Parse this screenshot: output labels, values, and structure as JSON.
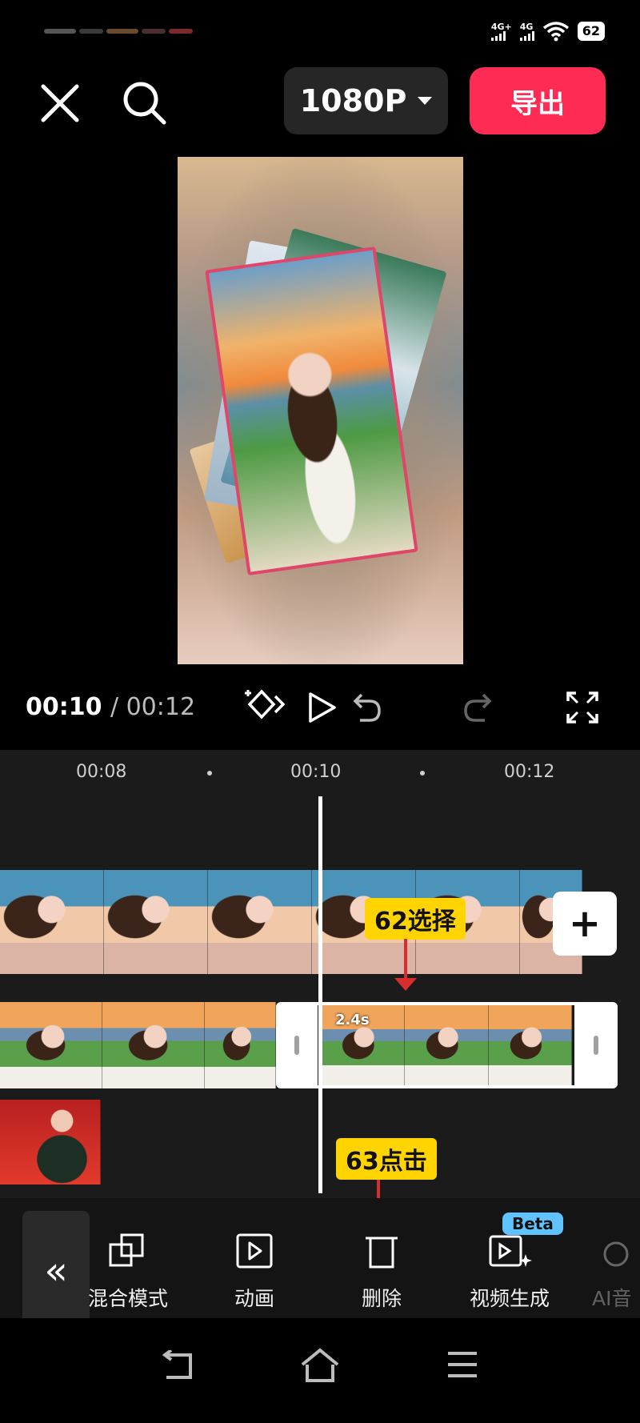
{
  "status_bar": {
    "network1": "4G+",
    "network2": "4G",
    "battery": "62"
  },
  "top_bar": {
    "close_icon": "close-icon",
    "search_icon": "search-icon",
    "resolution": "1080P",
    "export_label": "导出"
  },
  "player": {
    "current_time": "00:10",
    "total_time": "/ 00:12"
  },
  "timeline": {
    "ruler": [
      "00:08",
      "00:10",
      "00:12"
    ],
    "clip_duration": "2.4s"
  },
  "annotations": {
    "select_label": "62选择",
    "click_label": "63点击"
  },
  "toolbar": {
    "items": [
      {
        "label": "混合模式",
        "icon": "blend-mode-icon"
      },
      {
        "label": "动画",
        "icon": "animation-icon"
      },
      {
        "label": "删除",
        "icon": "delete-icon"
      },
      {
        "label": "视频生成",
        "icon": "video-generate-icon"
      }
    ],
    "beta_badge": "Beta",
    "partial_label": "AI音"
  },
  "colors": {
    "accent": "#fe2c55",
    "annotation": "#ffd400",
    "beta": "#5fc3ff"
  }
}
